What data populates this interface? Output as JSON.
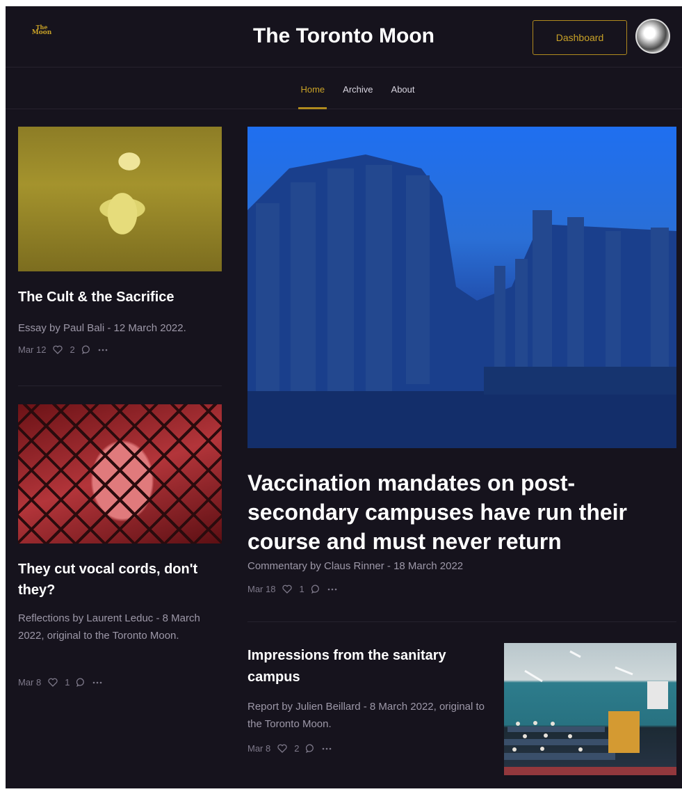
{
  "header": {
    "logo_line1": "The",
    "logo_line2": "Moon",
    "site_title": "The Toronto Moon",
    "dashboard_label": "Dashboard"
  },
  "nav": {
    "items": [
      {
        "label": "Home",
        "active": true
      },
      {
        "label": "Archive",
        "active": false
      },
      {
        "label": "About",
        "active": false
      }
    ]
  },
  "posts": [
    {
      "title": "The Cult & the Sacrifice",
      "subtitle": "Essay by Paul Bali - 12 March 2022.",
      "date": "Mar 12",
      "likes": "2",
      "image": "lamb-in-grass"
    },
    {
      "title": "They cut vocal cords, don't they?",
      "subtitle": "Reflections by Laurent Leduc - 8 March 2022, original to the Toronto Moon.",
      "date": "Mar 8",
      "likes": "1",
      "image": "chicken-behind-fence"
    },
    {
      "title": "Vaccination mandates on post-secondary campuses have run their course and must never return",
      "subtitle": "Commentary by Claus Rinner - 18 March 2022",
      "date": "Mar 18",
      "likes": "1",
      "image": "greek-temple-ruins"
    },
    {
      "title": "Impressions from the sanitary campus",
      "subtitle": "Report by Julien Beillard - 8 March 2022, original to the Toronto Moon.",
      "date": "Mar 8",
      "likes": "2",
      "image": "lecture-hall"
    }
  ],
  "icons": {
    "like": "heart-icon",
    "comment": "comment-icon",
    "more": "more-icon"
  },
  "colors": {
    "background": "#16131d",
    "accent": "#c9a227",
    "title": "#ffffff",
    "muted": "#9d98a8"
  }
}
